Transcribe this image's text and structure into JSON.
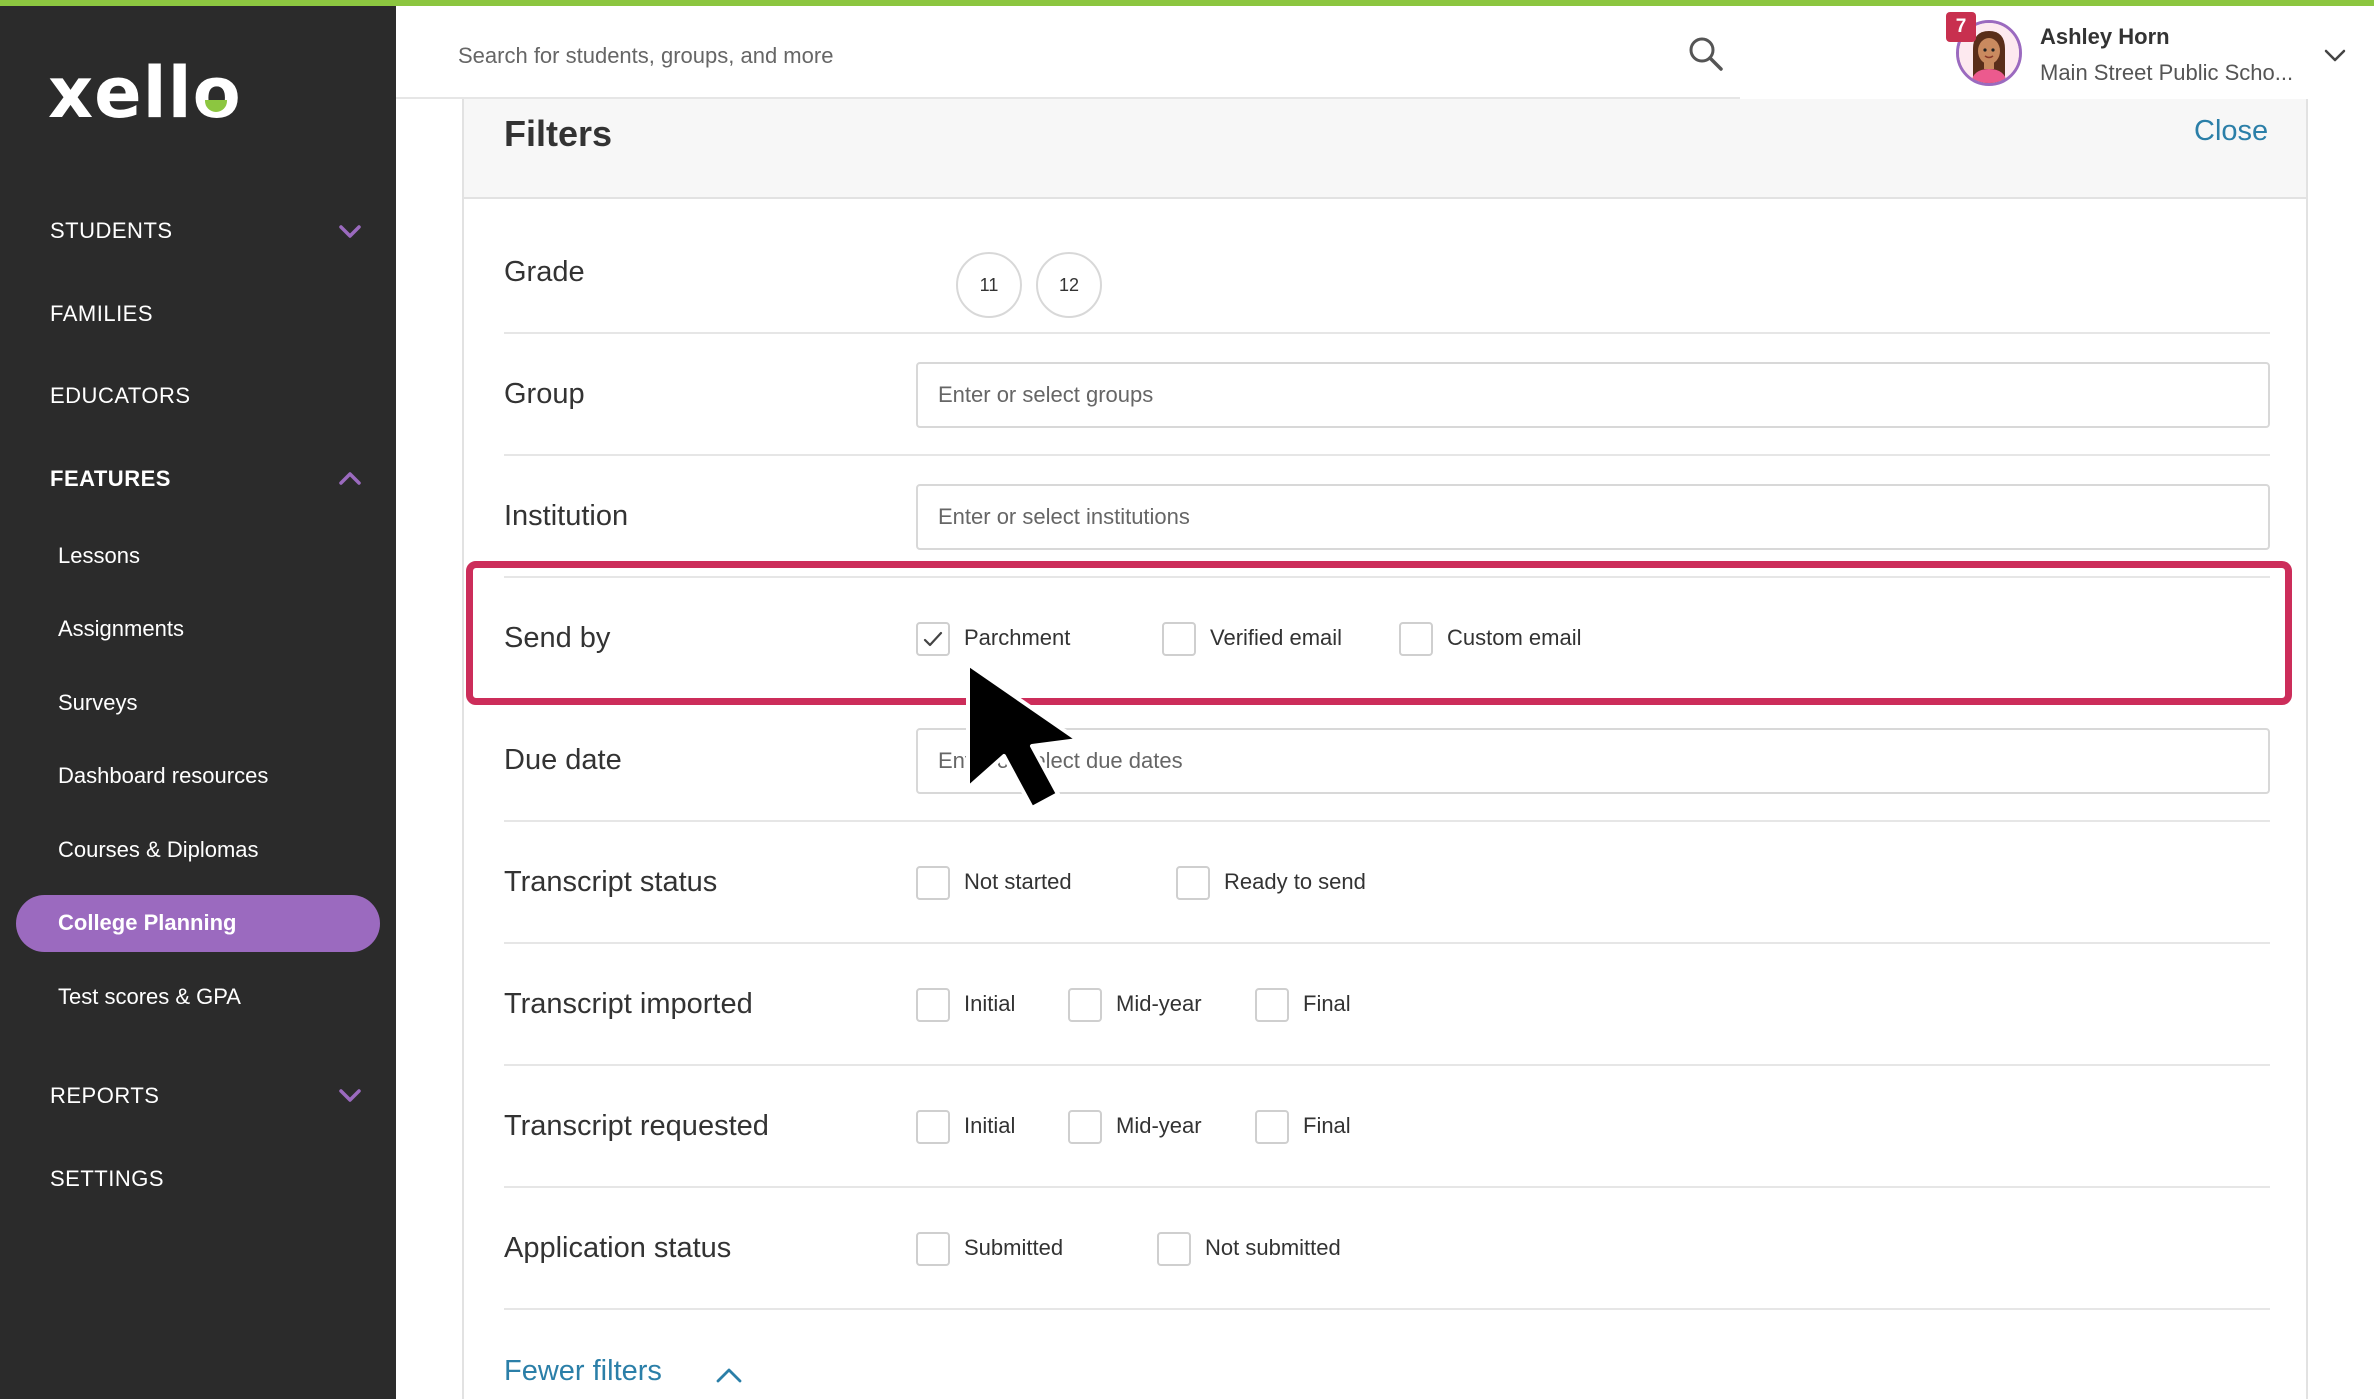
{
  "app": {
    "logo_text": "xello",
    "accent_color": "#9b6abf",
    "brand_green": "#8cc640"
  },
  "sidebar": {
    "students": "STUDENTS",
    "families": "FAMILIES",
    "educators": "EDUCATORS",
    "features": "FEATURES",
    "feature_items": {
      "lessons": "Lessons",
      "assignments": "Assignments",
      "surveys": "Surveys",
      "dashboard": "Dashboard resources",
      "courses": "Courses & Diplomas",
      "college": "College Planning",
      "tests": "Test scores & GPA"
    },
    "reports": "REPORTS",
    "settings": "SETTINGS"
  },
  "header": {
    "search_placeholder": "Search for students, groups, and more",
    "notification_count": "7",
    "user_name": "Ashley Horn",
    "user_school": "Main Street Public Scho..."
  },
  "filters": {
    "title": "Filters",
    "close_label": "Close",
    "grade": {
      "label": "Grade",
      "options": [
        "11",
        "12"
      ]
    },
    "group": {
      "label": "Group",
      "placeholder": "Enter or select groups"
    },
    "institution": {
      "label": "Institution",
      "placeholder": "Enter or select institutions"
    },
    "send_by": {
      "label": "Send by",
      "options": [
        "Parchment",
        "Verified email",
        "Custom email"
      ],
      "checked": "Parchment"
    },
    "due_date": {
      "label": "Due date",
      "placeholder": "Enter or select due dates"
    },
    "transcript_status": {
      "label": "Transcript status",
      "options": [
        "Not started",
        "Ready to send"
      ]
    },
    "transcript_imported": {
      "label": "Transcript imported",
      "options": [
        "Initial",
        "Mid-year",
        "Final"
      ]
    },
    "transcript_requested": {
      "label": "Transcript requested",
      "options": [
        "Initial",
        "Mid-year",
        "Final"
      ]
    },
    "application_status": {
      "label": "Application status",
      "options": [
        "Submitted",
        "Not submitted"
      ]
    },
    "fewer_label": "Fewer filters"
  }
}
